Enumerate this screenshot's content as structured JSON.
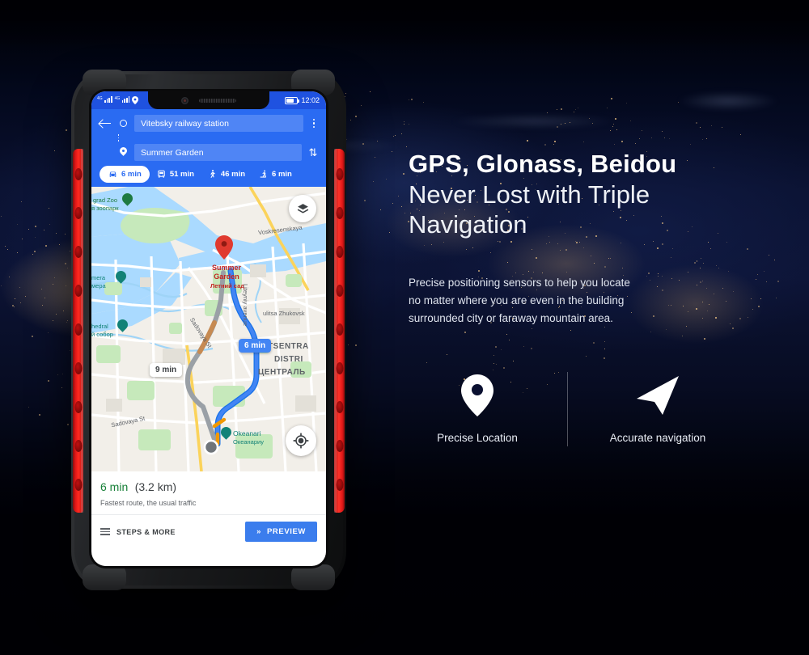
{
  "page": {
    "background": "earth-at-night-world-map",
    "bg_color": "#000007"
  },
  "marketing": {
    "headline_bold": "GPS, Glonass, Beidou",
    "headline_light_line1": "Never Lost with Triple",
    "headline_light_line2": "Navigation",
    "description_line1": "Precise positioning sensors to help you locate",
    "description_line2": "no matter where you are even in the building",
    "description_line3": "surrounded city or faraway mountain area.",
    "features": [
      {
        "icon": "location-pin-icon",
        "label": "Precise Location"
      },
      {
        "icon": "navigation-arrow-icon",
        "label": "Accurate navigation"
      }
    ]
  },
  "phone": {
    "frame_color": "#242527",
    "accent_color": "#e01717",
    "statusbar": {
      "network_1": "4G",
      "network_2": "4G",
      "location_icon": "location-pin-icon",
      "battery_icon": "battery-icon",
      "time": "12:02"
    },
    "app": {
      "name": "maps-directions",
      "accent": "#2a6bf2",
      "header": {
        "back_icon": "back-arrow-icon",
        "origin_icon": "origin-circle-icon",
        "origin_value": "Vitebsky railway station",
        "destination_icon": "destination-pin-icon",
        "destination_value": "Summer Garden",
        "overflow_icon": "kebab-menu-icon",
        "swap_icon": "swap-vertical-icon"
      },
      "modes": [
        {
          "icon": "car-icon",
          "label": "6 min",
          "active": true
        },
        {
          "icon": "transit-icon",
          "label": "51 min",
          "active": false
        },
        {
          "icon": "walk-icon",
          "label": "46 min",
          "active": false
        },
        {
          "icon": "rideshare-icon",
          "label": "6 min",
          "active": false
        }
      ],
      "map": {
        "layers_button_icon": "layers-icon",
        "recenter_button_icon": "my-location-icon",
        "destination_marker": "red-map-pin",
        "labels": [
          {
            "name": "zoo",
            "text": "grad Zoo"
          },
          {
            "name": "zoo-ru",
            "text": "я зоопарк"
          },
          {
            "name": "camera",
            "text": "mera"
          },
          {
            "name": "camera-ru",
            "text": "мера"
          },
          {
            "name": "cathedral",
            "text": "hedral"
          },
          {
            "name": "cathedral-ru",
            "text": "й собор"
          },
          {
            "name": "voskresenskaya",
            "text": "Voskresenskaya"
          },
          {
            "name": "summer-garden-en",
            "text": "Summer"
          },
          {
            "name": "summer-garden-en2",
            "text": "Garden"
          },
          {
            "name": "summer-garden-ru",
            "text": "Летний сад"
          },
          {
            "name": "liteyny",
            "text": "Liteyniy avenue"
          },
          {
            "name": "zhukovskogo",
            "text": "ulitsa Zhukovsk"
          },
          {
            "name": "sadovaya-1",
            "text": "Sadovaya St"
          },
          {
            "name": "sadovaya-2",
            "text": "Sadovaya St"
          },
          {
            "name": "district-1",
            "text": "TSENTRA"
          },
          {
            "name": "district-2",
            "text": "DISTRI"
          },
          {
            "name": "district-3",
            "text": "ЦЕНТРАЛЬ"
          },
          {
            "name": "okeanarium",
            "text": "Okeanari"
          },
          {
            "name": "okeanarium-ru",
            "text": "Океанариу"
          }
        ],
        "route_bubbles": [
          {
            "name": "primary-route-eta",
            "text": "6 min",
            "primary": true
          },
          {
            "name": "alternate-route-eta",
            "text": "9 min",
            "primary": false
          }
        ]
      },
      "route_card": {
        "duration": "6 min",
        "distance": "(3.2 km)",
        "subtitle": "Fastest route, the usual traffic",
        "steps_icon": "list-icon",
        "steps_label": "STEPS & MORE",
        "preview_icon": "chevrons-right-icon",
        "preview_label": "PREVIEW"
      }
    }
  }
}
